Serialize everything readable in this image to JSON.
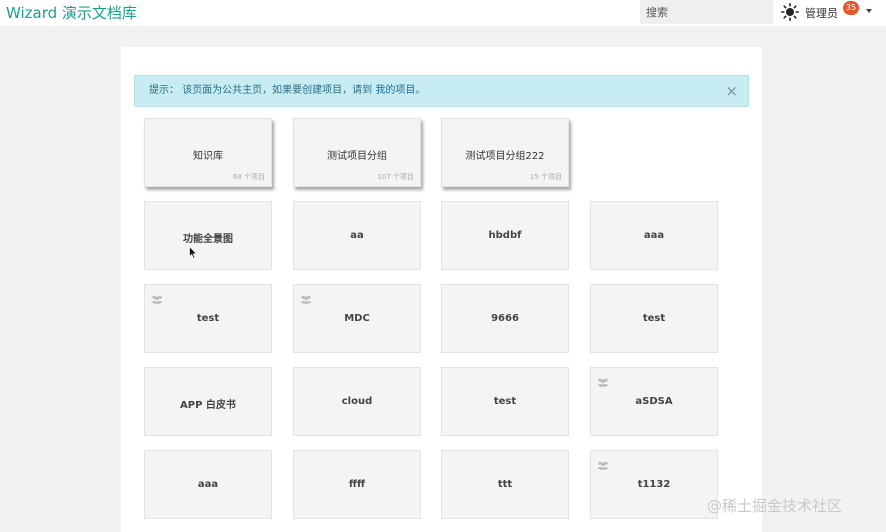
{
  "header": {
    "brand": "Wizard 演示文档库",
    "search_placeholder": "搜索",
    "theme_icon": "sun-icon",
    "user_name": "管理员",
    "notification_count": "35"
  },
  "alert": {
    "prefix": "提示：",
    "message": "该页面为公共主页，如果要创建项目，请到",
    "link": "我的项目",
    "suffix": "。",
    "close": "×"
  },
  "cards": [
    {
      "title": "知识库",
      "count": "68 个项目",
      "style": "group"
    },
    {
      "title": "测试项目分组",
      "count": "107 个项目",
      "style": "group"
    },
    {
      "title": "测试项目分组222",
      "count": "15 个项目",
      "style": "group"
    },
    {
      "title": "功能全景图",
      "icon": false
    },
    {
      "title": "aa",
      "icon": false
    },
    {
      "title": "hbdbf",
      "icon": false
    },
    {
      "title": "aaa",
      "icon": false
    },
    {
      "title": "test",
      "icon": true
    },
    {
      "title": "MDC",
      "icon": true
    },
    {
      "title": "9666",
      "icon": false
    },
    {
      "title": "test",
      "icon": false
    },
    {
      "title": "APP 白皮书",
      "icon": false
    },
    {
      "title": "cloud",
      "icon": false
    },
    {
      "title": "test",
      "icon": false
    },
    {
      "title": "aSDSA",
      "icon": true
    },
    {
      "title": "aaa",
      "icon": false
    },
    {
      "title": "ffff",
      "icon": false
    },
    {
      "title": "ttt",
      "icon": false
    },
    {
      "title": "t1132",
      "icon": true
    }
  ],
  "watermark": "@稀土掘金技术社区",
  "colors": {
    "brand": "#1e9e8a",
    "alert_bg": "#c7ecf2",
    "badge": "#e8572a",
    "card_bg": "#f4f4f4"
  }
}
